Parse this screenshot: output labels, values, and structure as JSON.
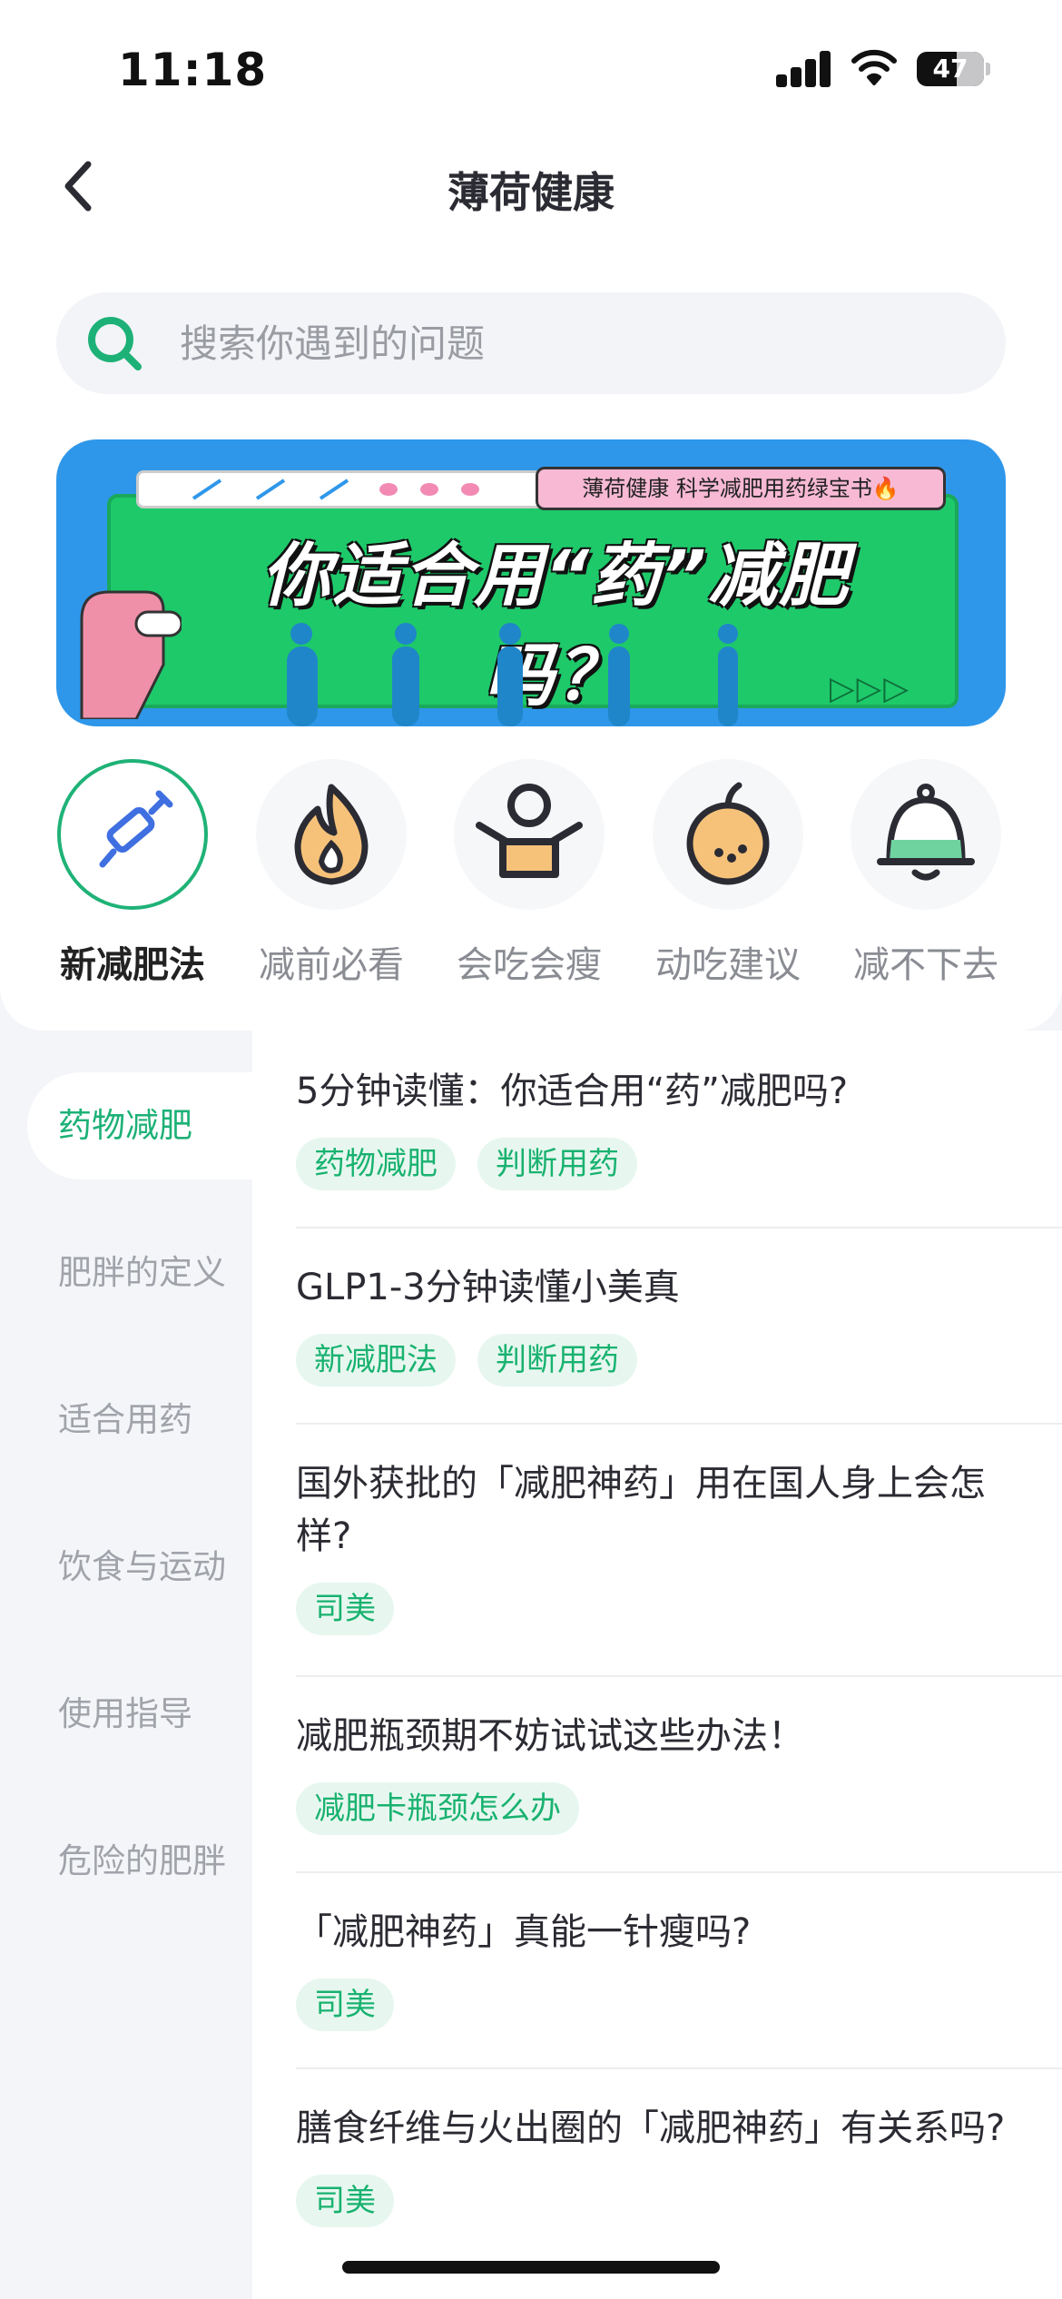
{
  "status_bar": {
    "time": "11:18",
    "battery": "47"
  },
  "nav": {
    "title": "薄荷健康"
  },
  "search": {
    "placeholder": "搜索你遇到的问题"
  },
  "banner": {
    "pill_text": "薄荷健康 科学减肥用药绿宝书🔥",
    "headline": "你适合用“药”减肥吗？",
    "arrows": "▷▷▷"
  },
  "categories": [
    {
      "label": "新减肥法",
      "icon": "syringe-icon",
      "active": true
    },
    {
      "label": "减前必看",
      "icon": "flame-icon"
    },
    {
      "label": "会吃会瘦",
      "icon": "person-cheer-icon"
    },
    {
      "label": "动吃建议",
      "icon": "orange-icon"
    },
    {
      "label": "减不下去",
      "icon": "bell-icon"
    }
  ],
  "sidebar": [
    {
      "label": "药物减肥",
      "active": true
    },
    {
      "label": "肥胖的定义"
    },
    {
      "label": "适合用药"
    },
    {
      "label": "饮食与运动"
    },
    {
      "label": "使用指导"
    },
    {
      "label": "危险的肥胖"
    }
  ],
  "articles": [
    {
      "title": "5分钟读懂：你适合用“药”减肥吗?",
      "tags": [
        "药物减肥",
        "判断用药"
      ]
    },
    {
      "title": "GLP1-3分钟读懂小美真",
      "tags": [
        "新减肥法",
        "判断用药"
      ]
    },
    {
      "title": "国外获批的「减肥神药」用在国人身上会怎样?",
      "tags": [
        "司美"
      ]
    },
    {
      "title": "减肥瓶颈期不妨试试这些办法！",
      "tags": [
        "减肥卡瓶颈怎么办"
      ]
    },
    {
      "title": "「减肥神药」真能一针瘦吗?",
      "tags": [
        "司美"
      ]
    },
    {
      "title": "膳食纤维与火出圈的「减肥神药」有关系吗?",
      "tags": [
        "司美"
      ]
    }
  ],
  "colors": {
    "accent": "#1db177",
    "tag_bg": "#e7f7ef"
  }
}
